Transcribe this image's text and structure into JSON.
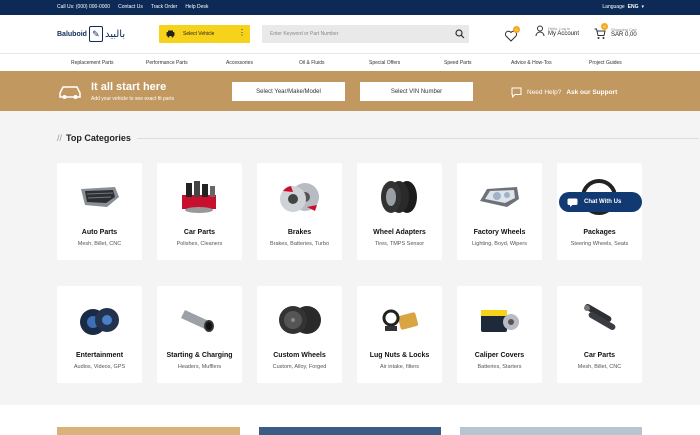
{
  "topbar": {
    "call": "Call Us: (000) 000-0000",
    "contact": "Contact Us",
    "track": "Track Order",
    "help": "Help Desk",
    "language_label": "Language",
    "language_value": "ENG"
  },
  "header": {
    "logo_en": "Baluboid",
    "logo_ar": "بالبيد",
    "select_vehicle": "Select Vehicle",
    "search_placeholder": "Enter Keyword or Part Number",
    "wishlist_count": "0",
    "account_small": "Hello, Log in",
    "account_big": "My Account",
    "cart_count": "0",
    "cart_small": "Shopping Cart",
    "cart_big": "SAR 0,00"
  },
  "nav": [
    "Replacement Parts",
    "Performance Parts",
    "Accessories",
    "Oil & Fluids",
    "Special Offers",
    "Speed Parts",
    "Advice & How-Tos",
    "Project Guides"
  ],
  "banner": {
    "title": "It all start here",
    "subtitle": "Add your vehicle to see exact fit parts",
    "btn_ymm": "Select Year/Make/Model",
    "btn_vin": "Select VIN Number",
    "help_q": "Need Help?",
    "help_link": "Ask our Support"
  },
  "section": {
    "slashes": "//",
    "title": "Top Categories"
  },
  "categories": [
    {
      "title": "Auto Parts",
      "desc": "Mesh, Billet, CNC",
      "icon": "grille-icon"
    },
    {
      "title": "Car Parts",
      "desc": "Polishes, Cleaners",
      "icon": "polish-kit-icon"
    },
    {
      "title": "Brakes",
      "desc": "Brakes, Batteries, Turbo",
      "icon": "brake-disc-icon"
    },
    {
      "title": "Wheel Adapters",
      "desc": "Tires, TMPS Sensor",
      "icon": "tires-icon"
    },
    {
      "title": "Factory Wheels",
      "desc": "Lighting, Boyd, Wipers",
      "icon": "headlight-icon"
    },
    {
      "title": "Packages",
      "desc": "Steering Wheels, Seats",
      "icon": "steering-wheel-icon"
    },
    {
      "title": "Entertainment",
      "desc": "Audios, Videos, GPS",
      "icon": "speaker-icon"
    },
    {
      "title": "Starting & Charging",
      "desc": "Headers, Mufflers",
      "icon": "exhaust-tip-icon"
    },
    {
      "title": "Custom Wheels",
      "desc": "Custom, Alloy, Forged",
      "icon": "alloy-wheels-icon"
    },
    {
      "title": "Lug Nuts & Locks",
      "desc": "Air intake, filters",
      "icon": "filters-icon"
    },
    {
      "title": "Caliper Covers",
      "desc": "Batteries, Starters",
      "icon": "battery-icon"
    },
    {
      "title": "Car Parts",
      "desc": "Mesh, Billet, CNC",
      "icon": "shocks-icon"
    }
  ],
  "chat": "Chat With Us",
  "colors": {
    "navy": "#0d2a57",
    "gold": "#c09860",
    "yellow": "#f7d21a",
    "badge": "#f7a81a"
  }
}
